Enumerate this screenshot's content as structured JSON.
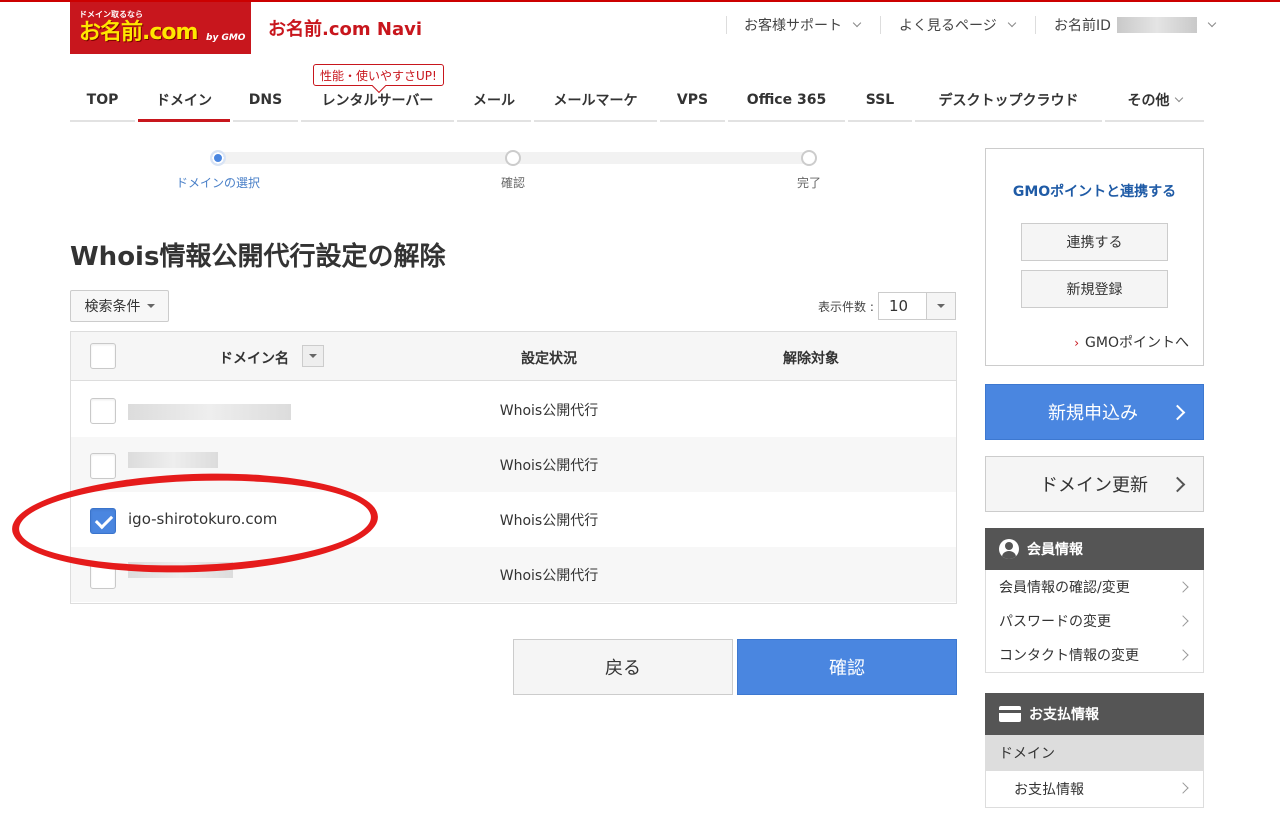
{
  "header": {
    "logo_tagline": "ドメイン取るなら",
    "logo_main": "お名前.com",
    "logo_gmo": "by GMO",
    "title": "お名前.com Navi",
    "support": "お客様サポート",
    "faq": "よく見るページ",
    "account_label": "お名前ID"
  },
  "tabs": [
    "TOP",
    "ドメイン",
    "DNS",
    "レンタルサーバー",
    "メール",
    "メールマーケ",
    "VPS",
    "Office 365",
    "SSL",
    "デスクトップクラウド",
    "その他"
  ],
  "promo_badge": "性能・使いやすさUP!",
  "steps": [
    "ドメインの選択",
    "確認",
    "完了"
  ],
  "page_title": "Whois情報公開代行設定の解除",
  "filter_button": "検索条件",
  "count": {
    "label": "表示件数 :",
    "value": "10"
  },
  "table": {
    "headers": [
      "ドメイン名",
      "設定状況",
      "解除対象"
    ],
    "rows": [
      {
        "domain": "",
        "status": "Whois公開代行",
        "checked": false
      },
      {
        "domain": "",
        "status": "Whois公開代行",
        "checked": false
      },
      {
        "domain": "igo-shirotokuro.com",
        "status": "Whois公開代行",
        "checked": true
      },
      {
        "domain": "",
        "status": "Whois公開代行",
        "checked": false
      }
    ]
  },
  "buttons": {
    "back": "戻る",
    "confirm": "確認"
  },
  "sidebar": {
    "gmo_title": "GMOポイントと連携する",
    "gmo_link_button": "連携する",
    "gmo_register_button": "新規登録",
    "gmo_points_link": "GMOポイントへ",
    "apply_button": "新規申込み",
    "renew_button": "ドメイン更新",
    "member_title": "会員情報",
    "member_items": [
      "会員情報の確認/変更",
      "パスワードの変更",
      "コンタクト情報の変更"
    ],
    "payment_title": "お支払情報",
    "payment_section": "ドメイン",
    "payment_items": [
      "お支払情報"
    ]
  },
  "colors": {
    "brand_red": "#c8161d",
    "accent_blue": "#4a86e0",
    "gmo_blue": "#1f5ba6"
  }
}
